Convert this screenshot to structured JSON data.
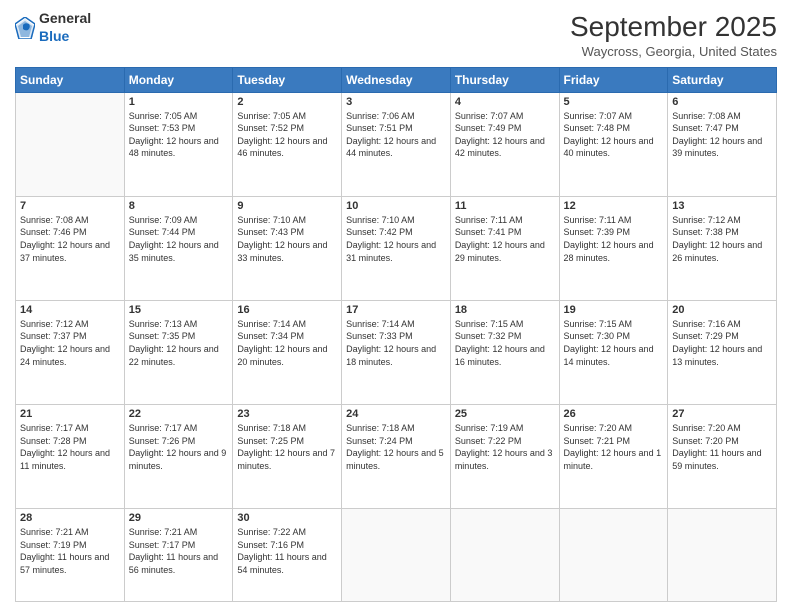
{
  "header": {
    "logo": {
      "general": "General",
      "blue": "Blue"
    },
    "title": "September 2025",
    "subtitle": "Waycross, Georgia, United States"
  },
  "weekdays": [
    "Sunday",
    "Monday",
    "Tuesday",
    "Wednesday",
    "Thursday",
    "Friday",
    "Saturday"
  ],
  "weeks": [
    [
      {
        "day": "",
        "sunrise": "",
        "sunset": "",
        "daylight": ""
      },
      {
        "day": "1",
        "sunrise": "Sunrise: 7:05 AM",
        "sunset": "Sunset: 7:53 PM",
        "daylight": "Daylight: 12 hours and 48 minutes."
      },
      {
        "day": "2",
        "sunrise": "Sunrise: 7:05 AM",
        "sunset": "Sunset: 7:52 PM",
        "daylight": "Daylight: 12 hours and 46 minutes."
      },
      {
        "day": "3",
        "sunrise": "Sunrise: 7:06 AM",
        "sunset": "Sunset: 7:51 PM",
        "daylight": "Daylight: 12 hours and 44 minutes."
      },
      {
        "day": "4",
        "sunrise": "Sunrise: 7:07 AM",
        "sunset": "Sunset: 7:49 PM",
        "daylight": "Daylight: 12 hours and 42 minutes."
      },
      {
        "day": "5",
        "sunrise": "Sunrise: 7:07 AM",
        "sunset": "Sunset: 7:48 PM",
        "daylight": "Daylight: 12 hours and 40 minutes."
      },
      {
        "day": "6",
        "sunrise": "Sunrise: 7:08 AM",
        "sunset": "Sunset: 7:47 PM",
        "daylight": "Daylight: 12 hours and 39 minutes."
      }
    ],
    [
      {
        "day": "7",
        "sunrise": "Sunrise: 7:08 AM",
        "sunset": "Sunset: 7:46 PM",
        "daylight": "Daylight: 12 hours and 37 minutes."
      },
      {
        "day": "8",
        "sunrise": "Sunrise: 7:09 AM",
        "sunset": "Sunset: 7:44 PM",
        "daylight": "Daylight: 12 hours and 35 minutes."
      },
      {
        "day": "9",
        "sunrise": "Sunrise: 7:10 AM",
        "sunset": "Sunset: 7:43 PM",
        "daylight": "Daylight: 12 hours and 33 minutes."
      },
      {
        "day": "10",
        "sunrise": "Sunrise: 7:10 AM",
        "sunset": "Sunset: 7:42 PM",
        "daylight": "Daylight: 12 hours and 31 minutes."
      },
      {
        "day": "11",
        "sunrise": "Sunrise: 7:11 AM",
        "sunset": "Sunset: 7:41 PM",
        "daylight": "Daylight: 12 hours and 29 minutes."
      },
      {
        "day": "12",
        "sunrise": "Sunrise: 7:11 AM",
        "sunset": "Sunset: 7:39 PM",
        "daylight": "Daylight: 12 hours and 28 minutes."
      },
      {
        "day": "13",
        "sunrise": "Sunrise: 7:12 AM",
        "sunset": "Sunset: 7:38 PM",
        "daylight": "Daylight: 12 hours and 26 minutes."
      }
    ],
    [
      {
        "day": "14",
        "sunrise": "Sunrise: 7:12 AM",
        "sunset": "Sunset: 7:37 PM",
        "daylight": "Daylight: 12 hours and 24 minutes."
      },
      {
        "day": "15",
        "sunrise": "Sunrise: 7:13 AM",
        "sunset": "Sunset: 7:35 PM",
        "daylight": "Daylight: 12 hours and 22 minutes."
      },
      {
        "day": "16",
        "sunrise": "Sunrise: 7:14 AM",
        "sunset": "Sunset: 7:34 PM",
        "daylight": "Daylight: 12 hours and 20 minutes."
      },
      {
        "day": "17",
        "sunrise": "Sunrise: 7:14 AM",
        "sunset": "Sunset: 7:33 PM",
        "daylight": "Daylight: 12 hours and 18 minutes."
      },
      {
        "day": "18",
        "sunrise": "Sunrise: 7:15 AM",
        "sunset": "Sunset: 7:32 PM",
        "daylight": "Daylight: 12 hours and 16 minutes."
      },
      {
        "day": "19",
        "sunrise": "Sunrise: 7:15 AM",
        "sunset": "Sunset: 7:30 PM",
        "daylight": "Daylight: 12 hours and 14 minutes."
      },
      {
        "day": "20",
        "sunrise": "Sunrise: 7:16 AM",
        "sunset": "Sunset: 7:29 PM",
        "daylight": "Daylight: 12 hours and 13 minutes."
      }
    ],
    [
      {
        "day": "21",
        "sunrise": "Sunrise: 7:17 AM",
        "sunset": "Sunset: 7:28 PM",
        "daylight": "Daylight: 12 hours and 11 minutes."
      },
      {
        "day": "22",
        "sunrise": "Sunrise: 7:17 AM",
        "sunset": "Sunset: 7:26 PM",
        "daylight": "Daylight: 12 hours and 9 minutes."
      },
      {
        "day": "23",
        "sunrise": "Sunrise: 7:18 AM",
        "sunset": "Sunset: 7:25 PM",
        "daylight": "Daylight: 12 hours and 7 minutes."
      },
      {
        "day": "24",
        "sunrise": "Sunrise: 7:18 AM",
        "sunset": "Sunset: 7:24 PM",
        "daylight": "Daylight: 12 hours and 5 minutes."
      },
      {
        "day": "25",
        "sunrise": "Sunrise: 7:19 AM",
        "sunset": "Sunset: 7:22 PM",
        "daylight": "Daylight: 12 hours and 3 minutes."
      },
      {
        "day": "26",
        "sunrise": "Sunrise: 7:20 AM",
        "sunset": "Sunset: 7:21 PM",
        "daylight": "Daylight: 12 hours and 1 minute."
      },
      {
        "day": "27",
        "sunrise": "Sunrise: 7:20 AM",
        "sunset": "Sunset: 7:20 PM",
        "daylight": "Daylight: 11 hours and 59 minutes."
      }
    ],
    [
      {
        "day": "28",
        "sunrise": "Sunrise: 7:21 AM",
        "sunset": "Sunset: 7:19 PM",
        "daylight": "Daylight: 11 hours and 57 minutes."
      },
      {
        "day": "29",
        "sunrise": "Sunrise: 7:21 AM",
        "sunset": "Sunset: 7:17 PM",
        "daylight": "Daylight: 11 hours and 56 minutes."
      },
      {
        "day": "30",
        "sunrise": "Sunrise: 7:22 AM",
        "sunset": "Sunset: 7:16 PM",
        "daylight": "Daylight: 11 hours and 54 minutes."
      },
      {
        "day": "",
        "sunrise": "",
        "sunset": "",
        "daylight": ""
      },
      {
        "day": "",
        "sunrise": "",
        "sunset": "",
        "daylight": ""
      },
      {
        "day": "",
        "sunrise": "",
        "sunset": "",
        "daylight": ""
      },
      {
        "day": "",
        "sunrise": "",
        "sunset": "",
        "daylight": ""
      }
    ]
  ]
}
